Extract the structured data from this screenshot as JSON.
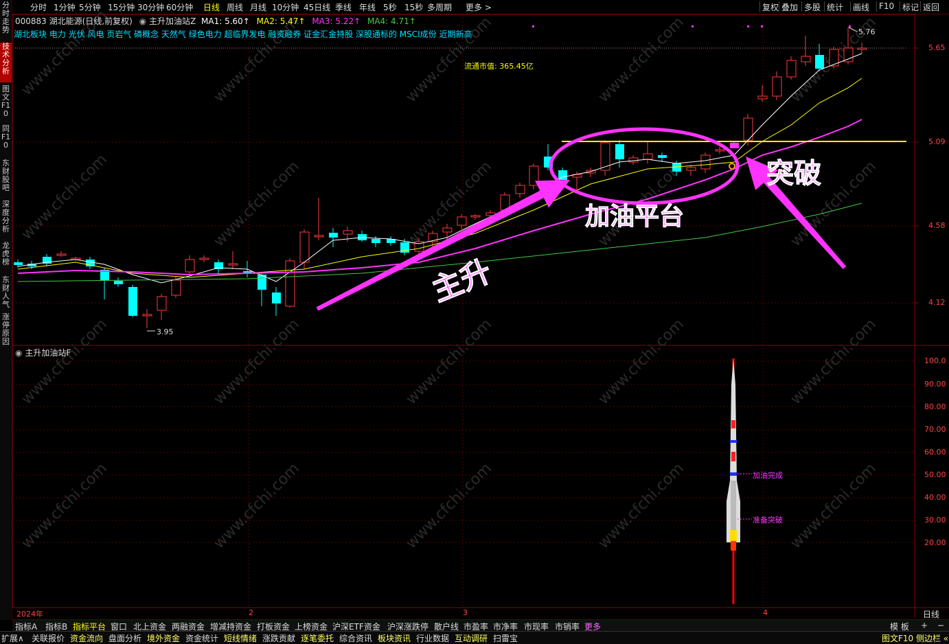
{
  "left_tabs": [
    {
      "label": "分时走势",
      "active": false
    },
    {
      "label": "技术分析",
      "active": true
    },
    {
      "label": "图文F10",
      "active": false
    },
    {
      "label": "同F10",
      "active": false
    },
    {
      "label": "东财股吧",
      "active": false
    },
    {
      "label": "深度分析",
      "active": false
    },
    {
      "label": "龙虎榜",
      "active": false
    },
    {
      "label": "东财人气",
      "active": false
    },
    {
      "label": "涨停原因",
      "active": false
    }
  ],
  "periods": [
    "分时",
    "1分钟",
    "5分钟",
    "15分钟",
    "30分钟",
    "60分钟",
    "日线",
    "周线",
    "月线",
    "10分钟",
    "45日线",
    "季线",
    "年线",
    "5秒",
    "15秒",
    "多周期",
    "更多 >"
  ],
  "active_period": "日线",
  "right_tools": [
    "复权",
    "叠加",
    "多股",
    "统计",
    "画线",
    "F10",
    "标记",
    "返回"
  ],
  "header": {
    "stock": "000883 湖北能源(日线,前复权)",
    "indicator": "主升加油站Z",
    "ma1": "MA1: 5.60↑",
    "ma2": "MA2: 5.47↑",
    "ma3": "MA3: 5.22↑",
    "ma4": "MA4: 4.71↑"
  },
  "concepts": "湖北板块 电力 光伏 风电 页岩气 磷概念 天然气 绿色电力 超临界发电 融资融券 证金汇金持股 深股通标的 MSCI成份 近期新高",
  "market_cap": "流通市值: 365.45亿",
  "price_axis": [
    "5.65",
    "5.09",
    "4.58",
    "4.12"
  ],
  "high_label": "5.76",
  "low_label": "3.95",
  "sub_title": "主升加油站F",
  "sub_axis": [
    "100.0",
    "90.00",
    "80.00",
    "70.00",
    "60.00",
    "50.00",
    "40.00",
    "30.00",
    "20.00"
  ],
  "rocket_labels": {
    "refuel": "加油完成",
    "prepare": "准备突破"
  },
  "annotations": {
    "breakout": "突破",
    "platform": "加油平台",
    "rise": "主升"
  },
  "time_axis": [
    "2024年",
    "2",
    "3",
    "4"
  ],
  "axis_mode": "日线",
  "bottom_tabs": [
    "指标A",
    "指标B",
    "指标平台",
    "窗口",
    "北上资金",
    "两融资金",
    "增减持资金",
    "打板资金",
    "上榜资金",
    "沪深ETF资金",
    "沪深涨跌停",
    "散户线",
    "市盈率",
    "市净率",
    "市现率",
    "市销率",
    "更多"
  ],
  "active_bottom_tab": "指标平台",
  "bottom_right": {
    "template": "模 板",
    "plus": "+",
    "minus": "−"
  },
  "status_bar": [
    "扩展∧",
    "关联报价",
    "资金流向",
    "盘面分析",
    "境外资金",
    "资金统计",
    "短线情绪",
    "涨跌贡献",
    "逐笔委托",
    "综合资讯",
    "板块资讯",
    "行业数据",
    "互动调研",
    "扫雷宝"
  ],
  "status_right": "图文F10 侧边栏 «",
  "watermark": "www.cfchi.com",
  "colors": {
    "up": "#ff3b3b",
    "down": "#00ffff",
    "magenta": "#ff33ff",
    "yellow": "#ffff00",
    "green": "#44cc44"
  }
}
